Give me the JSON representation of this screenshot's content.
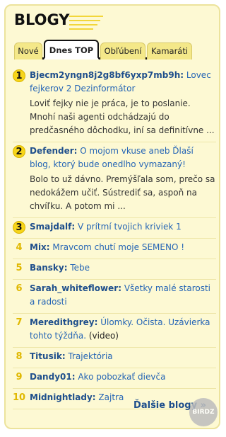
{
  "header": {
    "logo": "BLOGY"
  },
  "tabs": [
    {
      "label": "Nové"
    },
    {
      "label": "Dnes TOP"
    },
    {
      "label": "Obľúbení"
    },
    {
      "label": "Kamaráti"
    }
  ],
  "items": [
    {
      "num": "1",
      "author": "Bjecm2yngn8j2g8bf6yxp7mb9h:",
      "title": "Lovec fejkerov 2 Dezinformátor",
      "extra": "",
      "excerpt": "Loviť fejky nie je práca, je to poslanie. Mnohí naši agenti odchádzajú do predčasného dôchodku, iní sa definitívne ..."
    },
    {
      "num": "2",
      "author": "Defender:",
      "title": "O mojom vkuse aneb Ďlaší blog, ktorý bude onedlho vymazaný!",
      "extra": "",
      "excerpt": "Bolo to už dávno. Premýšľala som, prečo sa nedokážem učiť. Sústrediť sa, aspoň na chvíľku. A potom mi ..."
    },
    {
      "num": "3",
      "author": "Smajdalf:",
      "title": "V prítmí tvojich kriviek 1",
      "extra": "",
      "excerpt": ""
    },
    {
      "num": "4",
      "author": "Mix:",
      "title": "Mravcom chutí moje SEMENO !",
      "extra": "",
      "excerpt": ""
    },
    {
      "num": "5",
      "author": "Bansky:",
      "title": "Tebe",
      "extra": "",
      "excerpt": ""
    },
    {
      "num": "6",
      "author": "Sarah_whiteflower:",
      "title": "Všetky malé starosti a radosti",
      "extra": "",
      "excerpt": ""
    },
    {
      "num": "7",
      "author": "Meredithgrey:",
      "title": "Úlomky. Očista. Uzávierka tohto týždňa.",
      "extra": "(video)",
      "excerpt": ""
    },
    {
      "num": "8",
      "author": "Titusik:",
      "title": "Trajektória",
      "extra": "",
      "excerpt": ""
    },
    {
      "num": "9",
      "author": "Dandy01:",
      "title": "Ako pobozkať dievča",
      "extra": "",
      "excerpt": ""
    },
    {
      "num": "10",
      "author": "Midnightlady:",
      "title": "Zajtra",
      "extra": "",
      "excerpt": ""
    }
  ],
  "footer": {
    "more_label": "Ďalšie blogy »",
    "watermark": "BIRDZ"
  },
  "colors": {
    "background": "#fdf9d3",
    "accent_yellow": "#f7d51a",
    "link_blue": "#2565b5",
    "author_blue": "#1f4f8c"
  }
}
